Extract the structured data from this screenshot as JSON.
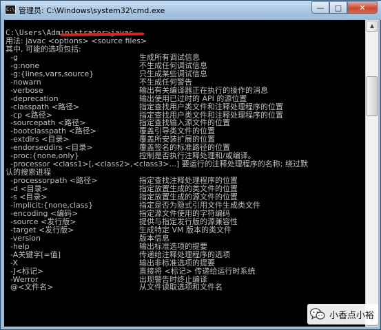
{
  "window": {
    "title": "管理员: C:\\Windows\\system32\\cmd.exe",
    "icon": "cmd-icon",
    "icon_text": "C:\\",
    "minimize": "—",
    "maximize": "□",
    "close": "✕"
  },
  "console": {
    "lines": [
      {
        "c1": "C:\\Users\\Administrator>javac"
      },
      {
        "c1": "用法: javac <options> <source files>"
      },
      {
        "c1": "其中, 可能的选项包括:"
      },
      {
        "c1": "  -g",
        "c2": "生成所有调试信息"
      },
      {
        "c1": "  -g:none",
        "c2": "不生成任何调试信息"
      },
      {
        "c1": "  -g:{lines,vars,source}",
        "c2": "只生成某些调试信息"
      },
      {
        "c1": "  -nowarn",
        "c2": "不生成任何警告"
      },
      {
        "c1": "  -verbose",
        "c2": "输出有关编译器正在执行的操作的消息"
      },
      {
        "c1": "  -deprecation",
        "c2": "输出使用已过时的 API 的源位置"
      },
      {
        "c1": "  -classpath <路径>",
        "c2": "指定查找用户类文件和注释处理程序的位置"
      },
      {
        "c1": "  -cp <路径>",
        "c2": "指定查找用户类文件和注释处理程序的位置"
      },
      {
        "c1": "  -sourcepath <路径>",
        "c2": "指定查找输入源文件的位置"
      },
      {
        "c1": "  -bootclasspath <路径>",
        "c2": "覆盖引导类文件的位置"
      },
      {
        "c1": "  -extdirs <目录>",
        "c2": "覆盖所安装扩展的位置"
      },
      {
        "c1": "  -endorseddirs <目录>",
        "c2": "覆盖签名的标准路径的位置"
      },
      {
        "c1": "  -proc:{none,only}",
        "c2": "控制是否执行注释处理和/或编译。"
      },
      {
        "c1": "  -processor <class1>[,<class2>,<class3>...] 要运行的注释处理程序的名称; 绕过默"
      },
      {
        "c1": "认的搜索进程"
      },
      {
        "c1": "  -processorpath <路径>",
        "c2": "指定查找注释处理程序的位置"
      },
      {
        "c1": "  -d <目录>",
        "c2": "指定放置生成的类文件的位置"
      },
      {
        "c1": "  -s <目录>",
        "c2": "指定放置生成的源文件的位置"
      },
      {
        "c1": "  -implicit:{none,class}",
        "c2": "指定是否为隐式引用文件生成类文件"
      },
      {
        "c1": "  -encoding <编码>",
        "c2": "指定源文件使用的字符编码"
      },
      {
        "c1": "  -source <发行版>",
        "c2": "提供与指定发行版的源兼容性"
      },
      {
        "c1": "  -target <发行版>",
        "c2": "生成特定 VM 版本的类文件"
      },
      {
        "c1": "  -version",
        "c2": "版本信息"
      },
      {
        "c1": "  -help",
        "c2": "输出标准选项的提要"
      },
      {
        "c1": "  -A关键字[=值]",
        "c2": "传递给注释处理程序的选项"
      },
      {
        "c1": "  -X",
        "c2": "输出非标准选项的提要"
      },
      {
        "c1": "  -J<标记>",
        "c2": "直接将 <标记> 传递给运行时系统"
      },
      {
        "c1": "  -Werror",
        "c2": "出现警告时终止编译"
      },
      {
        "c1": "  @<文件名>",
        "c2": "从文件读取选项和文件名"
      }
    ]
  },
  "watermark": {
    "text": "小香点小裕",
    "icon": "wechat-icon"
  },
  "colors": {
    "console_bg": "#000000",
    "console_text": "#c0c0c0",
    "underline": "#d0281e",
    "titlebar": "#b9d1ea"
  }
}
